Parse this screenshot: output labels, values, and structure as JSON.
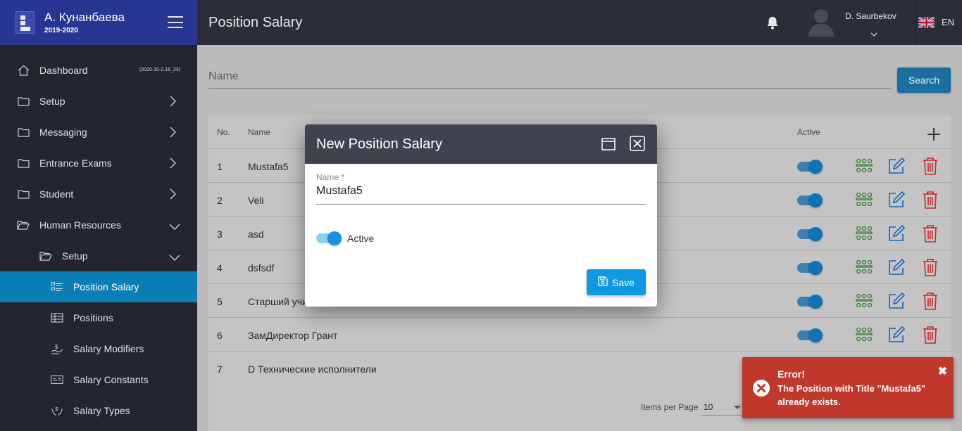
{
  "brand": {
    "title": "А. Кунанбаева",
    "year": "2019-2020"
  },
  "sidebar": {
    "items": [
      {
        "label": "Dashboard",
        "icon": "home-icon",
        "extra": "(2020-10-2.16_23)"
      },
      {
        "label": "Setup",
        "icon": "folder-icon"
      },
      {
        "label": "Messaging",
        "icon": "folder-icon"
      },
      {
        "label": "Entrance Exams",
        "icon": "folder-icon"
      },
      {
        "label": "Student",
        "icon": "folder-icon"
      },
      {
        "label": "Human Resources",
        "icon": "folder-open-icon"
      },
      {
        "label": "Setup",
        "icon": "folder-open-icon"
      },
      {
        "label": "Position Salary",
        "icon": "list-icon"
      },
      {
        "label": "Positions",
        "icon": "table-icon"
      },
      {
        "label": "Salary Modifiers",
        "icon": "money-hand-icon"
      },
      {
        "label": "Salary Constants",
        "icon": "card-icon"
      },
      {
        "label": "Salary Types",
        "icon": "hands-icon"
      }
    ]
  },
  "header": {
    "title": "Position Salary",
    "username": "D. Saurbekov",
    "language": "EN"
  },
  "search": {
    "placeholder": "Name",
    "button_label": "Search"
  },
  "table": {
    "columns": {
      "no": "No.",
      "name": "Name",
      "active": "Active"
    },
    "rows": [
      {
        "no": "1",
        "name": "Mustafa5"
      },
      {
        "no": "2",
        "name": "Veli"
      },
      {
        "no": "3",
        "name": "asd"
      },
      {
        "no": "4",
        "name": "dsfsdf"
      },
      {
        "no": "5",
        "name": "Старший учи"
      },
      {
        "no": "6",
        "name": "ЗамДиректор Грант"
      },
      {
        "no": "7",
        "name": "D Технические исполнители"
      }
    ]
  },
  "pager": {
    "label": "Items per Page",
    "value": "10"
  },
  "dialog": {
    "title": "New Position Salary",
    "name_label": "Name *",
    "name_value": "Mustafa5",
    "active_label": "Active",
    "save_label": "Save"
  },
  "toast": {
    "title": "Error!",
    "message": "The Position with Title \"Mustafa5\" already exists.",
    "close": "✖"
  },
  "colors": {
    "brand": "#283593",
    "active_nav": "#0b7fb5",
    "accent": "#1298e0",
    "error": "#c0372b"
  }
}
